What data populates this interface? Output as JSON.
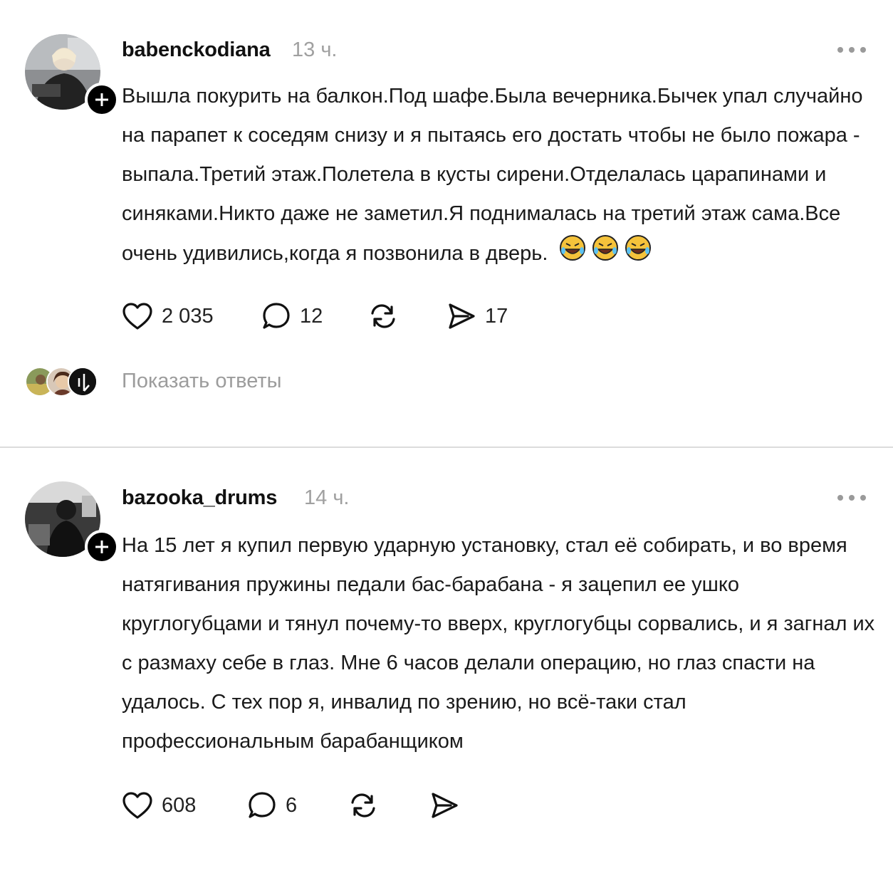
{
  "posts": [
    {
      "username": "babenckodiana",
      "time": "13 ч.",
      "text": "Вышла покурить на балкон.Под шафе.Была вечерника.Бычек упал случайно на парапет к соседям снизу и я пытаясь его достать чтобы не было пожара - выпала.Третий этаж.Полетела в кусты сирени.Отделалась царапинами и синяками.Никто даже не заметил.Я поднималась на третий этаж сама.Все очень удивились,когда я позвонила в дверь.",
      "emojis": [
        "rolling-on-floor-laughing-emoji",
        "rolling-on-floor-laughing-emoji",
        "rolling-on-floor-laughing-emoji"
      ],
      "likes": "2 035",
      "comments": "12",
      "shares": "17",
      "show_replies": "Показать ответы"
    },
    {
      "username": "bazooka_drums",
      "time": "14 ч.",
      "text": "На 15 лет я купил первую ударную установку, стал её собирать, и во время натягивания пружины педали бас-барабана - я зацепил ее ушко круглогубцами и тянул почему-то вверх, круглогубцы сорвались, и я загнал их с размаху себе в глаз. Мне 6 часов делали операцию, но глаз спасти на удалось. С тех пор я, инвалид по зрению, но всё-таки стал профессиональным барабанщиком",
      "likes": "608",
      "comments": "6"
    }
  ],
  "icons": {
    "like": "heart-icon",
    "comment": "comment-bubble-icon",
    "repost": "repost-icon",
    "share": "send-icon",
    "more": "more-dots-icon",
    "follow": "plus-icon"
  }
}
